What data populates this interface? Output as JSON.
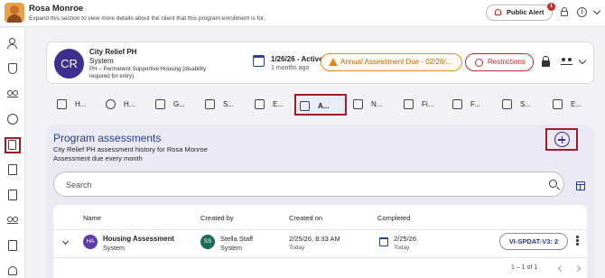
{
  "header": {
    "client_name": "Rosa Monroe",
    "subtitle": "Expand this section to view more details about the client that this program enrollment is for.",
    "public_alert_label": "Public Alert",
    "alert_count": "1"
  },
  "rail": {
    "icons": [
      "person-icon",
      "shield-icon",
      "people-icon",
      "history-icon",
      "enrollment-icon",
      "folder-icon",
      "document-icon",
      "household-icon",
      "copy-icon",
      "bell-icon"
    ]
  },
  "program": {
    "initials": "CR",
    "name": "City Relief PH",
    "system": "System",
    "description": "PH – Permanent Supportive Housing (disability required for entry)",
    "status_main": "1/26/26 - Active",
    "status_sub": "1 months ago",
    "assessment_due_label": "Annual Assessment Due - 02/26/...",
    "restrictions_label": "Restrictions"
  },
  "tabs": [
    {
      "label": "H..."
    },
    {
      "label": "H..."
    },
    {
      "label": "G..."
    },
    {
      "label": "S..."
    },
    {
      "label": "E..."
    },
    {
      "label": "A..."
    },
    {
      "label": "N..."
    },
    {
      "label": "Fi..."
    },
    {
      "label": "F..."
    },
    {
      "label": "S..."
    },
    {
      "label": "E..."
    }
  ],
  "assessments": {
    "title": "Program assessments",
    "subtitle": "City Relief PH assessment history for Rosa Monroe",
    "due_text": "Assessment due every month",
    "search_placeholder": "Search",
    "columns": {
      "name": "Name",
      "created_by": "Created by",
      "created_on": "Created on",
      "completed": "Completed"
    },
    "rows": [
      {
        "initials": "HA",
        "name": "Housing Assessment",
        "name_sub": "System",
        "creator_initials": "SS",
        "creator_name": "Stella Staff",
        "creator_sub": "System",
        "created_on": "2/25/26, 8:33 AM",
        "created_on_sub": "Today",
        "completed": "2/25/26",
        "completed_sub": "Today",
        "tool_label": "VI-SPDAT-V3: 2"
      }
    ],
    "pagination": "1 – 1 of 1"
  },
  "colors": {
    "accent": "#2b3c8f",
    "highlight_border": "#a01c2a",
    "warning": "#e08a1e",
    "danger": "#c62828",
    "program_avatar": "#3c2f8f"
  }
}
